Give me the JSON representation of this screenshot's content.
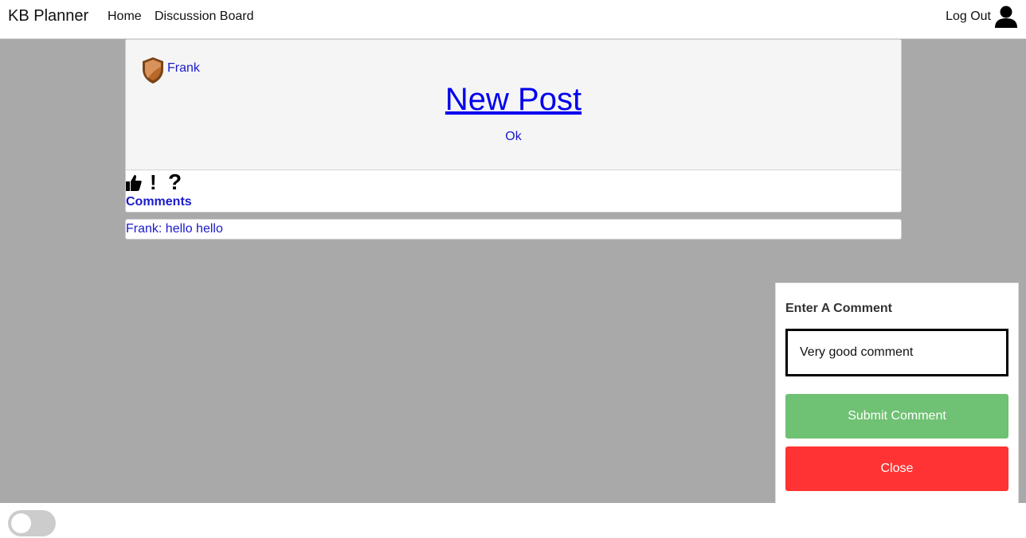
{
  "navbar": {
    "brand": "KB Planner",
    "links": [
      {
        "label": "Home"
      },
      {
        "label": "Discussion Board"
      }
    ],
    "logout_label": "Log Out",
    "user_icon": "user-icon"
  },
  "post": {
    "author": "Frank",
    "author_icon": "shield-badge-icon",
    "title": "New Post",
    "body": "Ok",
    "reactions": [
      {
        "icon": "thumbs-up-icon"
      },
      {
        "icon": "exclamation-icon",
        "glyph": "!"
      },
      {
        "icon": "question-icon",
        "glyph": "?"
      }
    ],
    "comments_label": "Comments"
  },
  "comments": [
    {
      "text": "Frank: hello hello"
    }
  ],
  "comment_form": {
    "title": "Enter A Comment",
    "input_value": "Very good comment",
    "submit_label": "Submit Comment",
    "close_label": "Close",
    "submit_color": "#6fc173",
    "close_color": "#ff3333"
  },
  "theme_toggle": {
    "state": "off"
  }
}
